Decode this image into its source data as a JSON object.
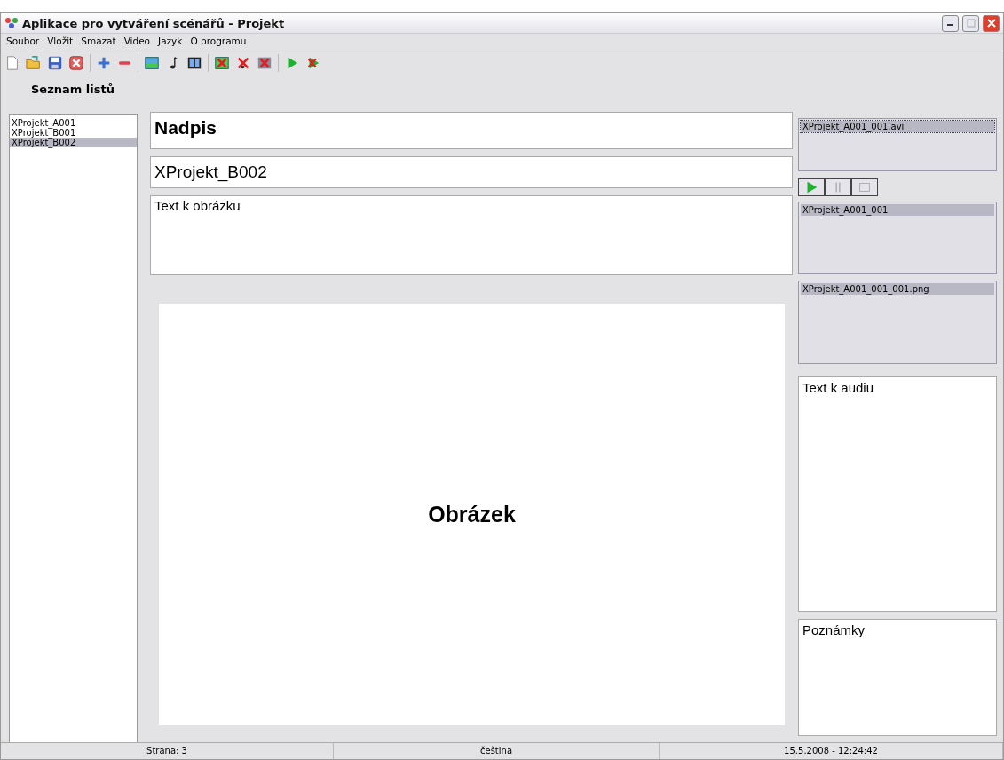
{
  "window": {
    "title": "Aplikace pro vytváření scénářů - Projekt"
  },
  "menu": [
    "Soubor",
    "Vložit",
    "Smazat",
    "Video",
    "Jazyk",
    "O programu"
  ],
  "toolbar": [
    {
      "kind": "new"
    },
    {
      "kind": "open"
    },
    {
      "kind": "save"
    },
    {
      "kind": "close"
    },
    {
      "kind": "sep"
    },
    {
      "kind": "add"
    },
    {
      "kind": "remove"
    },
    {
      "kind": "sep"
    },
    {
      "kind": "image"
    },
    {
      "kind": "note"
    },
    {
      "kind": "film"
    },
    {
      "kind": "sep"
    },
    {
      "kind": "del-image"
    },
    {
      "kind": "del-note"
    },
    {
      "kind": "del-film"
    },
    {
      "kind": "sep"
    },
    {
      "kind": "play"
    },
    {
      "kind": "stop-play"
    }
  ],
  "sheets": {
    "heading": "Seznam listů",
    "items": [
      {
        "label": "XProjekt_A001",
        "selected": false
      },
      {
        "label": "XProjekt_B001",
        "selected": false
      },
      {
        "label": "XProjekt_B002",
        "selected": true
      }
    ]
  },
  "editor": {
    "title": "Nadpis",
    "name": "XProjekt_B002",
    "image_text": "Text k obrázku",
    "image_label": "Obrázek"
  },
  "side": {
    "videos": [
      {
        "label": "XProjekt_A001_001.avi",
        "selected": true
      }
    ],
    "player": [
      {
        "kind": "play"
      },
      {
        "kind": "pause"
      },
      {
        "kind": "stop"
      }
    ],
    "sounds": [
      {
        "label": "XProjekt_A001_001",
        "selected": true
      }
    ],
    "images": [
      {
        "label": "XProjekt_A001_001_001.png",
        "selected": true
      }
    ],
    "audio_text": "Text k audiu",
    "notes": "Poznámky"
  },
  "status_bar": [
    "Strana: 3",
    "čeština",
    "15.5.2008 - 12:24:42"
  ]
}
